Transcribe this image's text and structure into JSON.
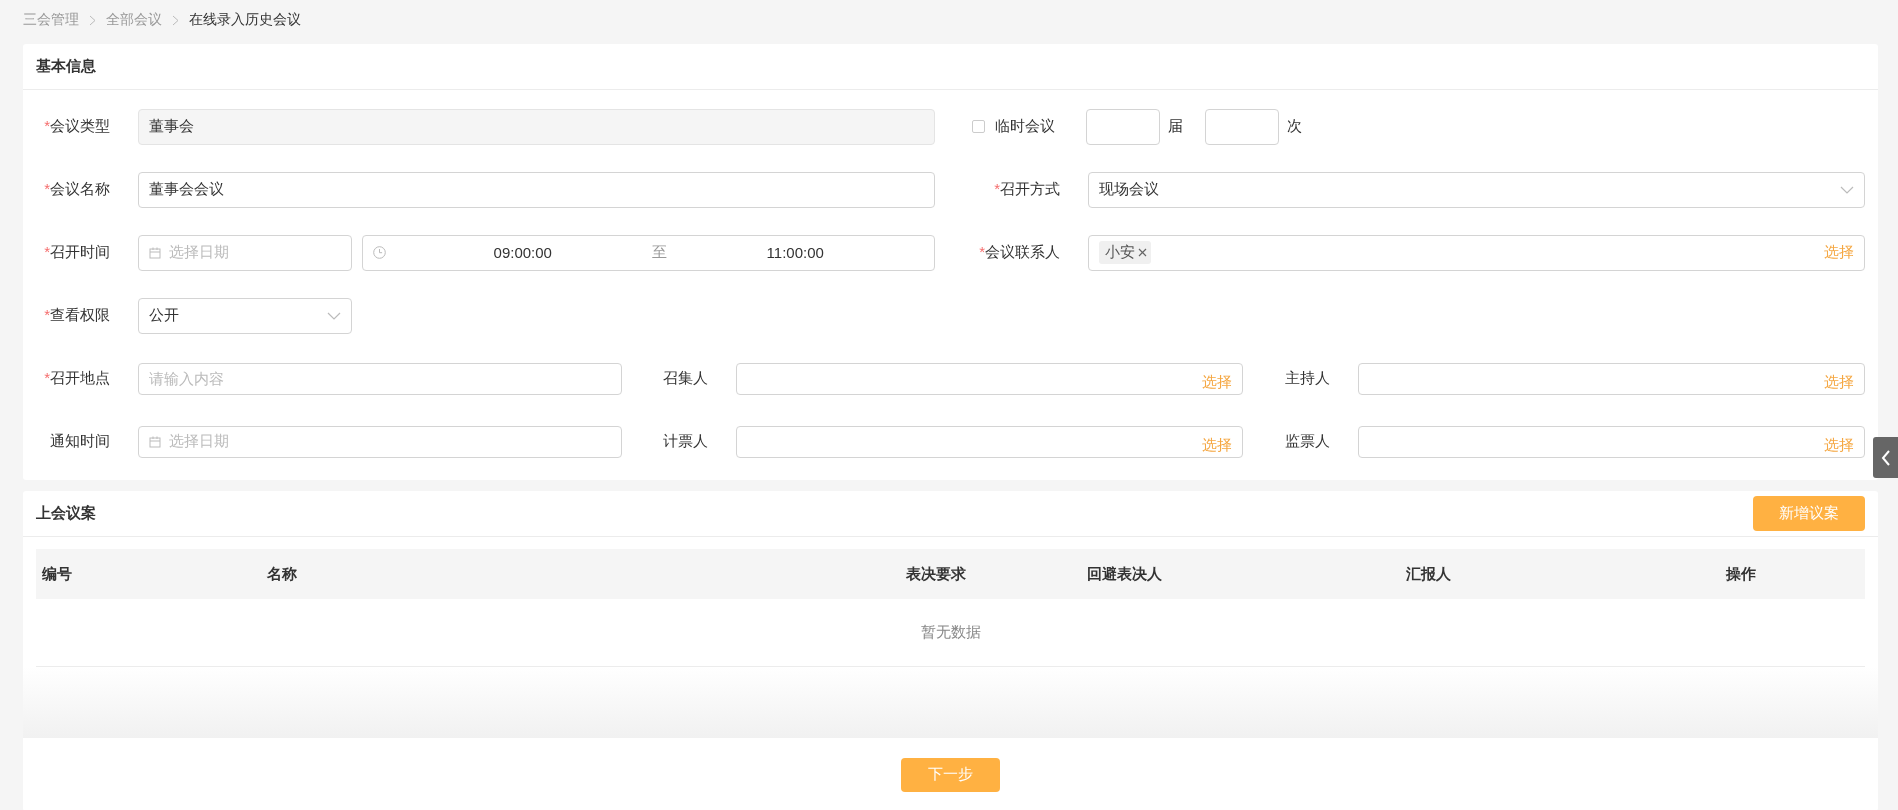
{
  "breadcrumb": [
    {
      "label": "三会管理",
      "current": false
    },
    {
      "label": "全部会议",
      "current": false
    },
    {
      "label": "在线录入历史会议",
      "current": true
    }
  ],
  "basic_info": {
    "title": "基本信息",
    "upper_rows": [
      {
        "fields": [
          {
            "kind": "input",
            "mark": "*",
            "label": "会议类型",
            "value": "董事会",
            "disabled": true
          },
          {
            "kind": "session-counts",
            "label": "临时会议",
            "checked": false,
            "units": [
              "届",
              "次"
            ]
          }
        ]
      },
      {
        "fields": [
          {
            "kind": "input",
            "mark": "*",
            "label": "会议名称",
            "value": "董事会会议",
            "disabled": false
          },
          {
            "kind": "select",
            "mark": "*",
            "label": "召开方式",
            "value": "现场会议"
          }
        ]
      },
      {
        "fields": [
          {
            "kind": "date-time-range",
            "mark": "*",
            "label": "召开时间",
            "date_placeholder": "选择日期",
            "start": "09:00:00",
            "separator": "至",
            "end": "11:00:00"
          },
          {
            "kind": "tag-picker",
            "mark": "*",
            "label": "会议联系人",
            "tags": [
              {
                "label": "小安"
              }
            ],
            "action": "选择"
          }
        ]
      },
      {
        "fields": [
          {
            "kind": "short-select",
            "mark": "*",
            "label": "查看权限",
            "value": "公开"
          }
        ]
      }
    ],
    "lower_rows": [
      {
        "fields": [
          {
            "kind": "input",
            "mark": "*",
            "label": "召开地点",
            "placeholder": "请输入内容",
            "disabled": false
          },
          {
            "kind": "picker",
            "label": "召集人",
            "action": "选择"
          },
          {
            "kind": "picker",
            "label": "主持人",
            "action": "选择"
          }
        ]
      },
      {
        "fields": [
          {
            "kind": "date",
            "label": "通知时间",
            "placeholder": "选择日期"
          },
          {
            "kind": "picker",
            "label": "计票人",
            "action": "选择"
          },
          {
            "kind": "picker",
            "label": "监票人",
            "action": "选择"
          }
        ]
      }
    ]
  },
  "proposals": {
    "title": "上会议案",
    "add_button": "新增议案",
    "columns": [
      "编号",
      "名称",
      "表决要求",
      "回避表决人",
      "汇报人",
      "操作"
    ],
    "empty_text": "暂无数据"
  },
  "next_button": "下一步"
}
